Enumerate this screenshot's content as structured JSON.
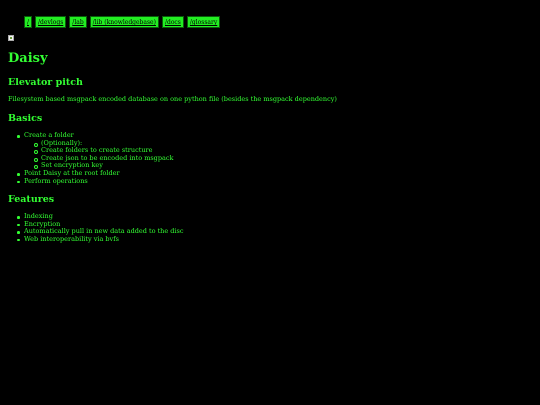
{
  "nav": {
    "items": [
      "/",
      "/devlogs",
      "/lab",
      "/lib (knowledgebase)",
      "/docs",
      "/glossary"
    ]
  },
  "page": {
    "title": "Daisy",
    "image_alt_icon": "broken-image-icon"
  },
  "sections": {
    "pitch": {
      "heading": "Elevator pitch",
      "text": "Filesystem based msgpack encoded database on one python file (besides the msgpack dependency)"
    },
    "basics": {
      "heading": "Basics",
      "items": [
        {
          "text": "Create a folder",
          "children": [
            "(Optionally):",
            "Create folders to create structure",
            "Create json to be encoded into msgpack",
            "Set encryption key"
          ]
        },
        {
          "text": "Point Daisy at the root folder",
          "children": []
        },
        {
          "text": "Perform operations",
          "children": []
        }
      ]
    },
    "features": {
      "heading": "Features",
      "items": [
        "Indexing",
        "Encryption",
        "Automatically pull in new data added to the disc",
        "Web interoperability via bvfs"
      ]
    }
  },
  "colors": {
    "background": "#000000",
    "text": "#33ff33",
    "nav_button_bg": "#22ee22"
  }
}
